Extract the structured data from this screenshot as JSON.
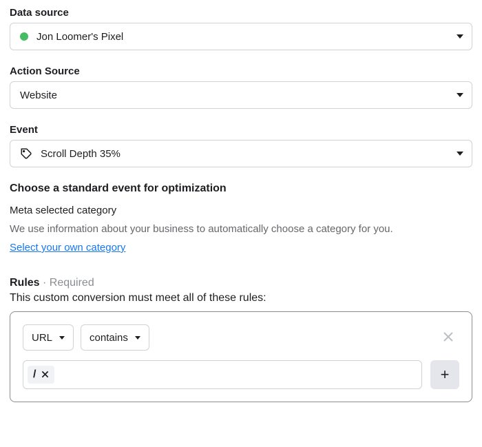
{
  "data_source": {
    "label": "Data source",
    "selected": "Jon Loomer's Pixel"
  },
  "action_source": {
    "label": "Action Source",
    "selected": "Website"
  },
  "event": {
    "label": "Event",
    "selected": "Scroll Depth 35%"
  },
  "optimization": {
    "heading": "Choose a standard event for optimization",
    "meta_label": "Meta selected category",
    "help": "We use information about your business to automatically choose a category for you.",
    "link": "Select your own category"
  },
  "rules": {
    "label": "Rules",
    "required": " · Required",
    "description": "This custom conversion must meet all of these rules:",
    "field": "URL",
    "operator": "contains",
    "token": "/",
    "add": "+"
  }
}
